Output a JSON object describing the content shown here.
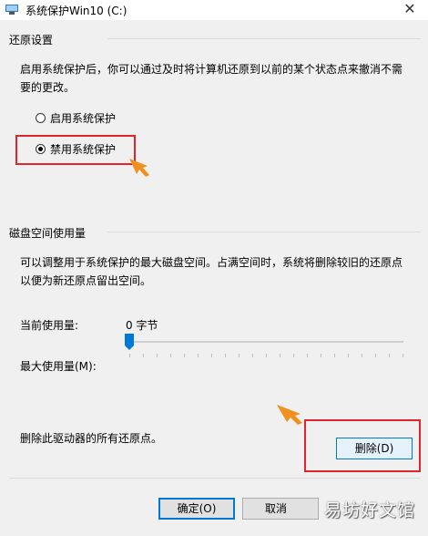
{
  "window": {
    "title": "系统保护Win10 (C:)",
    "close_glyph": "✕"
  },
  "restore": {
    "group_title": "还原设置",
    "desc_line1": "启用系统保护后，你可以通过及时将计算机还原到以前的某个状态点来撤消不需",
    "desc_line2": "要的更改。",
    "options": [
      {
        "label": "启用系统保护",
        "checked": false
      },
      {
        "label": "禁用系统保护",
        "checked": true
      }
    ]
  },
  "disk": {
    "group_title": "磁盘空间使用量",
    "desc_line1": "可以调整用于系统保护的最大磁盘空间。占满空间时，系统将删除较旧的还原点",
    "desc_line2": "以便为新还原点留出空间。",
    "current_label": "当前使用量:",
    "current_value": "0 字节",
    "max_label": "最大使用量(M):",
    "max_usage_fraction": 0
  },
  "delete": {
    "label": "删除此驱动器的所有还原点。",
    "button": "删除(D)"
  },
  "footer": {
    "ok": "确定(O)",
    "cancel": "取消",
    "watermark": "易坊好文馆"
  },
  "colors": {
    "highlight": "#e0262c",
    "arrow": "#f0901e",
    "accent": "#0078d7"
  }
}
